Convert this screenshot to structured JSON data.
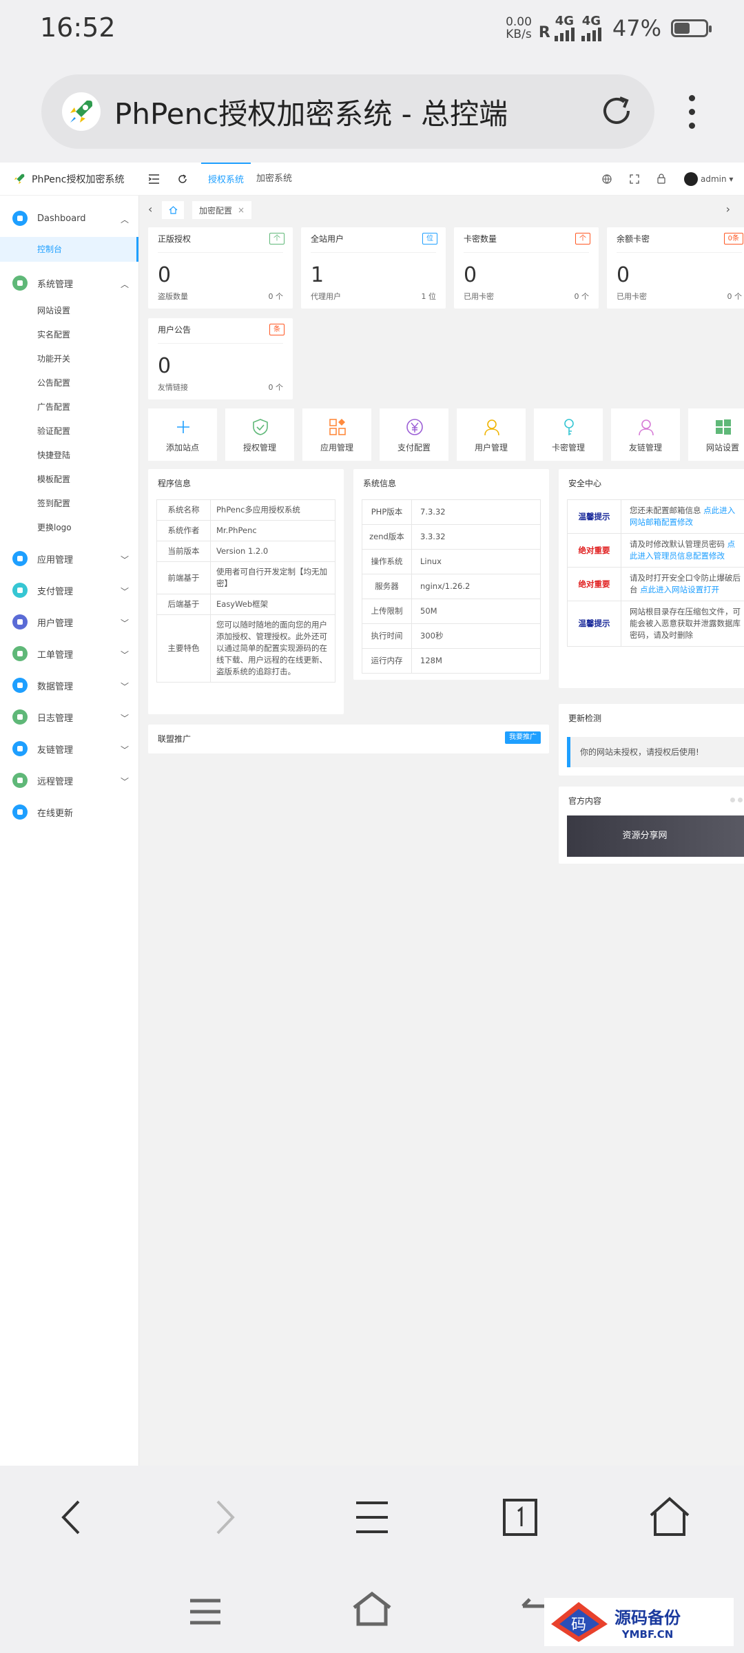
{
  "status_bar": {
    "time": "16:52",
    "net_speed": "0.00",
    "net_unit": "KB/s",
    "roaming": "R",
    "sig1": "4G",
    "sig2": "4G",
    "battery": "47%"
  },
  "browser": {
    "page_title": "PhPenc授权加密系统 - 总控端"
  },
  "app": {
    "name": "PhPenc授权加密系统",
    "topnav": [
      "授权系统",
      "加密系统"
    ],
    "user": "admin"
  },
  "sidebar": {
    "dashboard": "Dashboard",
    "dashboard_items": [
      "控制台"
    ],
    "system": "系统管理",
    "system_items": [
      "网站设置",
      "实名配置",
      "功能开关",
      "公告配置",
      "广告配置",
      "验证配置",
      "快捷登陆",
      "模板配置",
      "签到配置",
      "更换logo"
    ],
    "groups": [
      "应用管理",
      "支付管理",
      "用户管理",
      "工单管理",
      "数据管理",
      "日志管理",
      "友链管理",
      "远程管理",
      "在线更新"
    ]
  },
  "tabs": {
    "current": "加密配置"
  },
  "stats": [
    {
      "title": "正版授权",
      "badge": "个",
      "value": "0",
      "foot_label": "盗版数量",
      "foot_value": "0 个"
    },
    {
      "title": "全站用户",
      "badge": "位",
      "value": "1",
      "foot_label": "代理用户",
      "foot_value": "1 位"
    },
    {
      "title": "卡密数量",
      "badge": "个",
      "value": "0",
      "foot_label": "已用卡密",
      "foot_value": "0 个"
    },
    {
      "title": "余额卡密",
      "badge": "0条",
      "value": "0",
      "foot_label": "已用卡密",
      "foot_value": "0 个"
    },
    {
      "title": "用户公告",
      "badge": "条",
      "value": "0",
      "foot_label": "友情链接",
      "foot_value": "0 个"
    }
  ],
  "quick": [
    "添加站点",
    "授权管理",
    "应用管理",
    "支付配置",
    "用户管理",
    "卡密管理",
    "友链管理",
    "网站设置"
  ],
  "program_info": {
    "title": "程序信息",
    "rows": [
      {
        "k": "系统名称",
        "v": "PhPenc多应用授权系统"
      },
      {
        "k": "系统作者",
        "v": "Mr.PhPenc"
      },
      {
        "k": "当前版本",
        "v": "Version 1.2.0"
      },
      {
        "k": "前端基于",
        "v": "使用者可自行开发定制【均无加密】"
      },
      {
        "k": "后端基于",
        "v": "EasyWeb框架"
      },
      {
        "k": "主要特色",
        "v": "您可以随时随地的面向您的用户添加授权、管理授权。此外还可以通过简单的配置实现源码的在线下载、用户远程的在线更新、盗版系统的追踪打击。"
      }
    ]
  },
  "system_info": {
    "title": "系统信息",
    "rows": [
      {
        "k": "PHP版本",
        "v": "7.3.32"
      },
      {
        "k": "zend版本",
        "v": "3.3.32"
      },
      {
        "k": "操作系统",
        "v": "Linux"
      },
      {
        "k": "服务器",
        "v": "nginx/1.26.2"
      },
      {
        "k": "上传限制",
        "v": "50M"
      },
      {
        "k": "执行时间",
        "v": "300秒"
      },
      {
        "k": "运行内存",
        "v": "128M"
      }
    ]
  },
  "security": {
    "title": "安全中心",
    "rows": [
      {
        "k": "温馨提示",
        "text": "您还未配置邮箱信息 ",
        "link": "点此进入网站邮箱配置修改"
      },
      {
        "k": "绝对重要",
        "text": "请及时修改默认管理员密码 ",
        "link": "点此进入管理员信息配置修改"
      },
      {
        "k": "绝对重要",
        "text": "请及时打开安全口令防止爆破后台 ",
        "link": "点此进入网站设置打开"
      },
      {
        "k": "温馨提示",
        "text": "网站根目录存在压缩包文件，可能会被入恶意获取并泄露数据库密码，请及时删除",
        "link": ""
      }
    ]
  },
  "affiliate": {
    "title": "联盟推广",
    "button": "我要推广"
  },
  "update": {
    "title": "更新检测",
    "message": "你的网站未授权，请授权后使用!"
  },
  "official": {
    "title": "官方内容",
    "banner": "资源分享网"
  },
  "watermark": {
    "char": "码",
    "cn": "源码备份",
    "en": "YMBF.CN"
  },
  "colors": {
    "primary": "#1e9fff",
    "green": "#5fb878",
    "red": "#ff5722"
  }
}
